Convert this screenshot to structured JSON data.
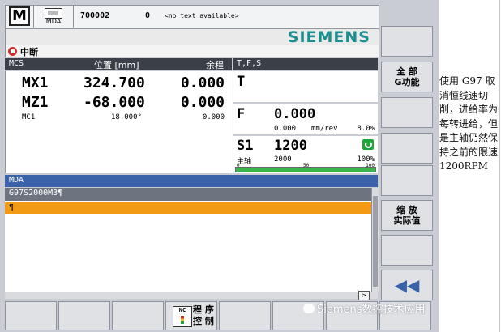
{
  "header": {
    "mode_symbol": "M",
    "mda_label": "MDA",
    "program_number": "700002",
    "channel": "0",
    "message": "<no text available>"
  },
  "brand": "SIEMENS",
  "brand_color": "#1a8f8f",
  "status": {
    "text": "中断",
    "icon": "stop-icon",
    "color": "#d32a2a"
  },
  "coords": {
    "header_mcs": "MCS",
    "header_pos": "位置 [mm]",
    "header_dist": "余程",
    "header_tfs": "T,F,S",
    "rows": [
      {
        "axis": "MX1",
        "pos": "324.700",
        "dist": "0.000"
      },
      {
        "axis": "MZ1",
        "pos": "-68.000",
        "dist": "0.000"
      }
    ],
    "small_row": {
      "axis": "MC1",
      "pos": "18.000°",
      "dist": "0.000"
    }
  },
  "tfs": {
    "t_label": "T",
    "f_label": "F",
    "f_value": "0.000",
    "f_sub": "0.000",
    "f_unit": "mm/rev",
    "f_pct": "8.0%",
    "s_label": "S1",
    "s_value": "1200",
    "s_name": "主轴",
    "s_sub": "2000",
    "s_pct": "100%",
    "s_bar_fraction": 1.0,
    "s_ticks": [
      "0",
      "50",
      "100"
    ]
  },
  "editor": {
    "title": "MDA",
    "filename": "G97S2000M3¶",
    "current_line": "¶",
    "scroll_right": ">"
  },
  "right_softkeys": [
    {
      "id": "sk1",
      "label": ""
    },
    {
      "id": "sk2",
      "line1": "全 部",
      "line2": "G功能"
    },
    {
      "id": "sk3",
      "label": ""
    },
    {
      "id": "sk4",
      "label": ""
    },
    {
      "id": "sk5",
      "label": ""
    },
    {
      "id": "sk6",
      "line1": "缩 放",
      "line2": "实际值"
    },
    {
      "id": "sk7",
      "label": ""
    },
    {
      "id": "sk8",
      "label": ""
    }
  ],
  "back_softkey": "◀◀",
  "bottom_softkeys": {
    "program_control_1": "程 序",
    "program_control_2": "控 制",
    "nc_icon_text": "NC"
  },
  "watermark": "Siemens数控技术应用",
  "caption": "使用 G97 取消恒线速切削，进给率为每转进给，但是主轴仍然保持之前的限速 1200RPM"
}
